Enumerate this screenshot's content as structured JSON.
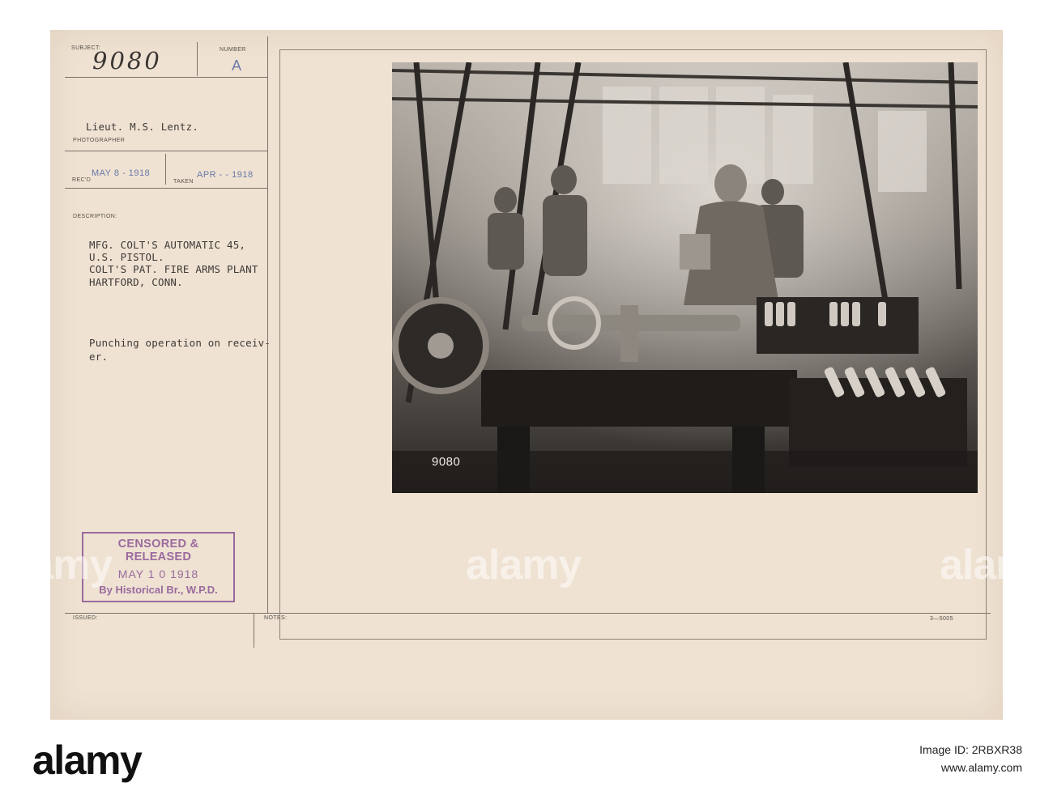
{
  "record": {
    "subject_label": "SUBJECT:",
    "subject_value": "9080",
    "number_label": "NUMBER",
    "number_value": "A",
    "photographer_name": "Lieut. M.S. Lentz.",
    "photographer_label": "PHOTOGRAPHER",
    "recd_label": "REC'D",
    "recd_date": "MAY 8 - 1918",
    "taken_label": "TAKEN",
    "taken_date": "APR - - 1918",
    "description_label": "DESCRIPTION:",
    "description_lines": [
      "MFG. COLT'S AUTOMATIC 45,",
      "U.S. PISTOL.",
      "COLT'S PAT. FIRE ARMS PLANT",
      "HARTFORD, CONN."
    ],
    "caption_lines": [
      "Punching operation on receiv-",
      "er."
    ],
    "issued_label": "ISSUED:",
    "notes_label": "NOTES:",
    "form_code": "3—5005"
  },
  "stamp": {
    "line1": "CENSORED & RELEASED",
    "line2": "MAY 1 0 1918",
    "line3": "By Historical Br., W.P.D."
  },
  "photo": {
    "negative_number": "9080"
  },
  "watermarks": {
    "text": "alamy"
  },
  "footer": {
    "logo": "alamy",
    "image_id_label": "Image ID: 2RBXR38",
    "site": "www.alamy.com"
  }
}
